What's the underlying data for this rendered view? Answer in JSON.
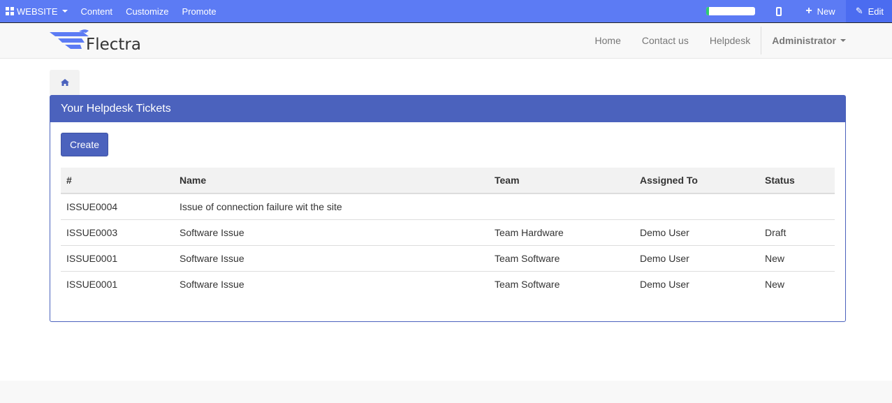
{
  "adminbar": {
    "website_label": "WEBSITE",
    "menu": [
      "Content",
      "Customize",
      "Promote"
    ],
    "progress_fraction": 0.05,
    "new_label": "New",
    "edit_label": "Edit"
  },
  "brand": {
    "name": "Flectra",
    "color": "#5c7bf4"
  },
  "nav": {
    "links": [
      "Home",
      "Contact us",
      "Helpdesk"
    ],
    "user": "Administrator"
  },
  "breadcrumb": {
    "icon": "home-icon"
  },
  "panel": {
    "title": "Your Helpdesk Tickets",
    "create_label": "Create",
    "columns": [
      "#",
      "Name",
      "Team",
      "Assigned To",
      "Status"
    ],
    "rows": [
      [
        "ISSUE0004",
        "Issue of connection failure wit the site",
        "",
        "",
        ""
      ],
      [
        "ISSUE0003",
        "Software Issue",
        "Team Hardware",
        "Demo User",
        "Draft"
      ],
      [
        "ISSUE0001",
        "Software Issue",
        "Team Software",
        "Demo User",
        "New"
      ],
      [
        "ISSUE0001",
        "Software Issue",
        "Team Software",
        "Demo User",
        "New"
      ]
    ]
  },
  "colors": {
    "adminbar": "#5c7bf4",
    "primary": "#4b62bd",
    "progress": "#2ecc71"
  }
}
